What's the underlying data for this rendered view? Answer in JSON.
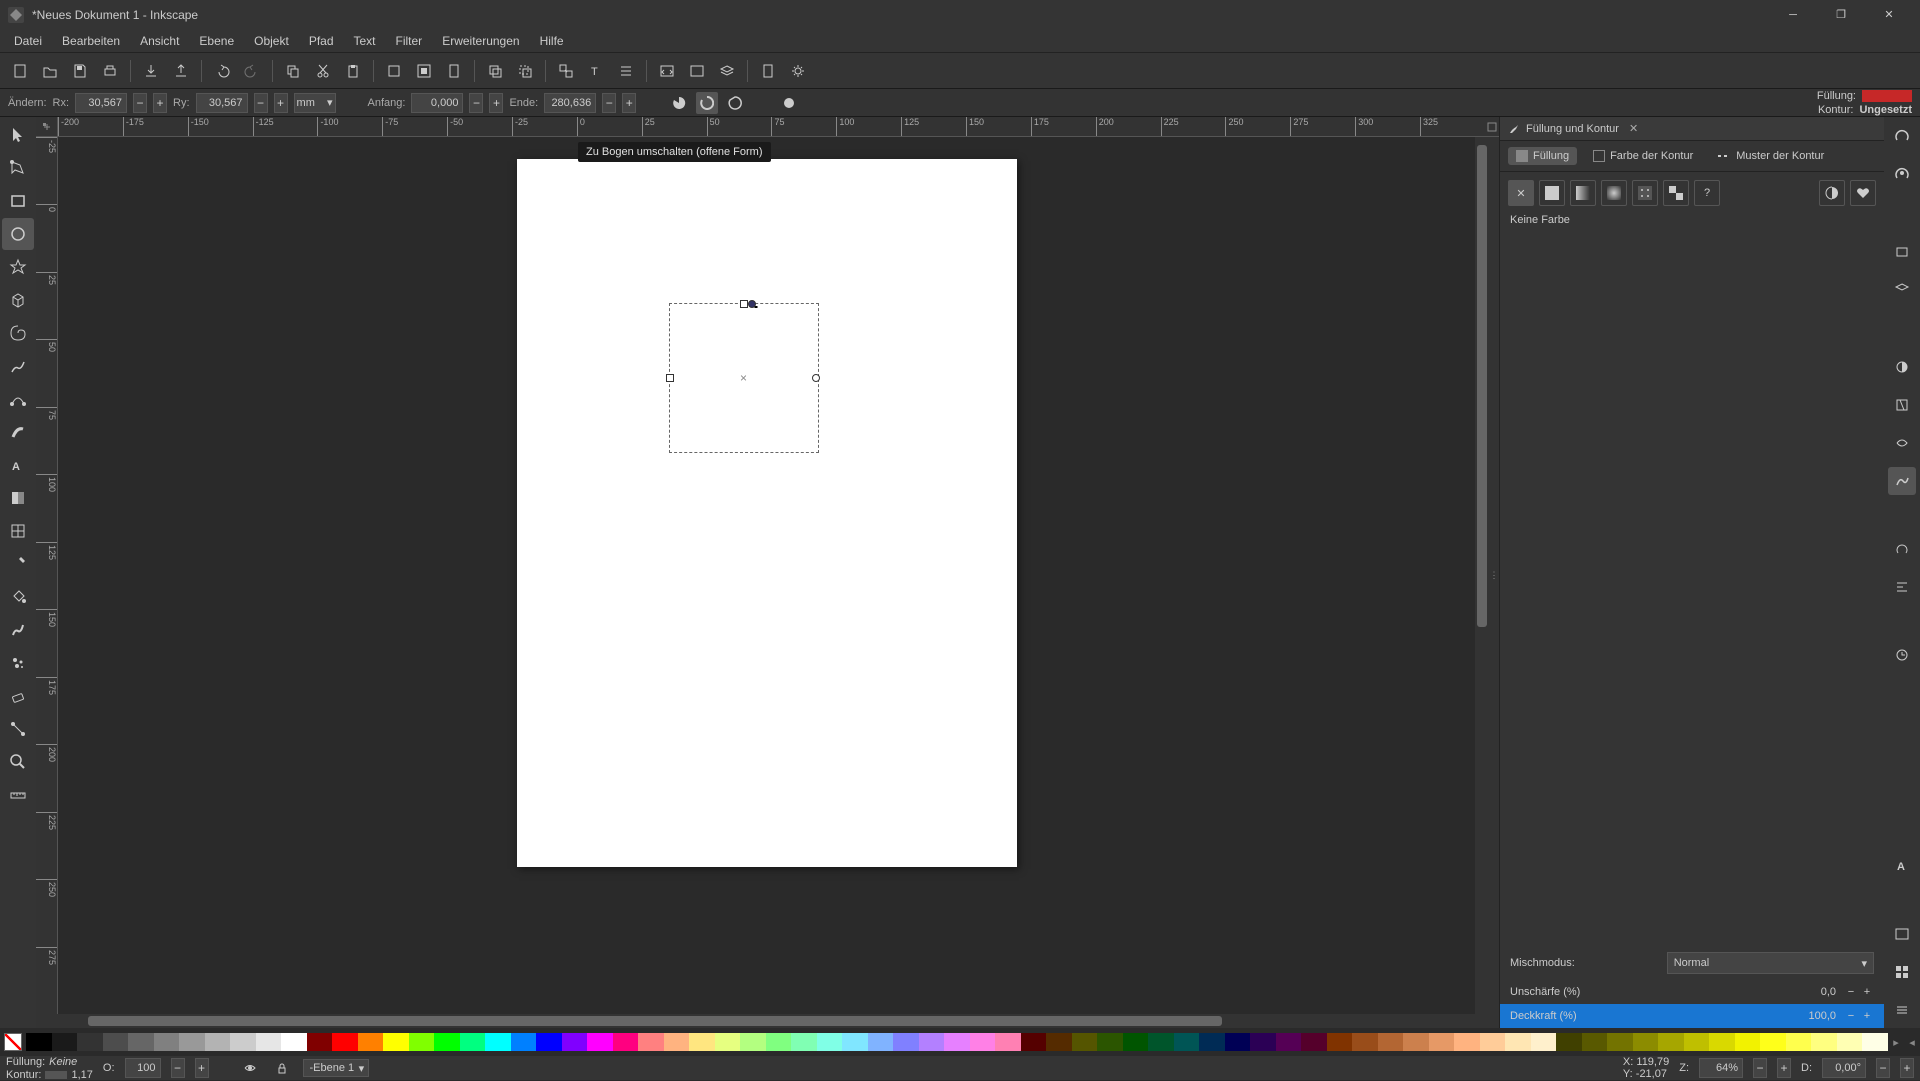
{
  "window": {
    "title": "*Neues Dokument 1 - Inkscape"
  },
  "menu": [
    "Datei",
    "Bearbeiten",
    "Ansicht",
    "Ebene",
    "Objekt",
    "Pfad",
    "Text",
    "Filter",
    "Erweiterungen",
    "Hilfe"
  ],
  "tool_options": {
    "change_label": "Ändern:",
    "rx_label": "Rx:",
    "rx_val": "30,567",
    "ry_label": "Ry:",
    "ry_val": "30,567",
    "unit": "mm",
    "start_label": "Anfang:",
    "start_val": "0,000",
    "end_label": "Ende:",
    "end_val": "280,636",
    "fill_label": "Füllung:",
    "stroke_label": "Kontur:",
    "stroke_val": "Ungesetzt"
  },
  "tooltip": "Zu Bogen umschalten (offene Form)",
  "ruler_h": [
    "-200",
    "-175",
    "-150",
    "-125",
    "-100",
    "-75",
    "-50",
    "-25",
    "0",
    "25",
    "50",
    "75",
    "100",
    "125",
    "150",
    "175",
    "200",
    "225",
    "250",
    "275",
    "300",
    "325"
  ],
  "ruler_v": [
    "-25",
    "0",
    "25",
    "50",
    "75",
    "100",
    "125",
    "150",
    "175",
    "200",
    "225",
    "250",
    "275"
  ],
  "panel": {
    "title": "Füllung und Kontur",
    "tabs": {
      "fill": "Füllung",
      "stroke": "Farbe der Kontur",
      "pattern": "Muster der Kontur"
    },
    "no_color": "Keine Farbe",
    "blend_label": "Mischmodus:",
    "blend_val": "Normal",
    "blur_label": "Unschärfe (%)",
    "blur_val": "0,0",
    "opacity_label": "Deckkraft (%)",
    "opacity_val": "100,0"
  },
  "status": {
    "fill_label": "Füllung:",
    "fill_val": "Keine",
    "stroke_label": "Kontur:",
    "stroke_w": "1,17",
    "o_label": "O:",
    "o_val": "100",
    "layer": "-Ebene 1",
    "x_label": "X:",
    "x_val": "119,79",
    "y_label": "Y:",
    "y_val": "-21,07",
    "z_label": "Z:",
    "z_val": "64%",
    "d_label": "D:",
    "d_val": "0,00°"
  },
  "palette": [
    "#000",
    "#1a1a1a",
    "#333",
    "#4d4d4d",
    "#666",
    "#808080",
    "#999",
    "#b3b3b3",
    "#ccc",
    "#e6e6e6",
    "#fff",
    "#800000",
    "#f00",
    "#ff8000",
    "#ff0",
    "#80ff00",
    "#0f0",
    "#00ff80",
    "#0ff",
    "#0080ff",
    "#00f",
    "#8000ff",
    "#f0f",
    "#ff0080",
    "#ff8080",
    "#ffb380",
    "#ffe680",
    "#e6ff80",
    "#b3ff80",
    "#80ff80",
    "#80ffb3",
    "#80ffe6",
    "#80e6ff",
    "#80b3ff",
    "#8080ff",
    "#b380ff",
    "#e680ff",
    "#ff80e6",
    "#ff80b3",
    "#550000",
    "#552b00",
    "#555500",
    "#2b5500",
    "#005500",
    "#00552b",
    "#005555",
    "#002b55",
    "#000055",
    "#2b0055",
    "#550055",
    "#55002b",
    "#803300",
    "#994d1a",
    "#b36633",
    "#cc804d",
    "#e69966",
    "#ffb380",
    "#ffcc99",
    "#ffe6b3",
    "#fff0cc",
    "#404000",
    "#595900",
    "#737300",
    "#8c8c00",
    "#a6a600",
    "#bfbf00",
    "#d9d900",
    "#f2f200",
    "#ffff1a",
    "#ffff4d",
    "#ffff80",
    "#ffffb3",
    "#ffffe6"
  ]
}
